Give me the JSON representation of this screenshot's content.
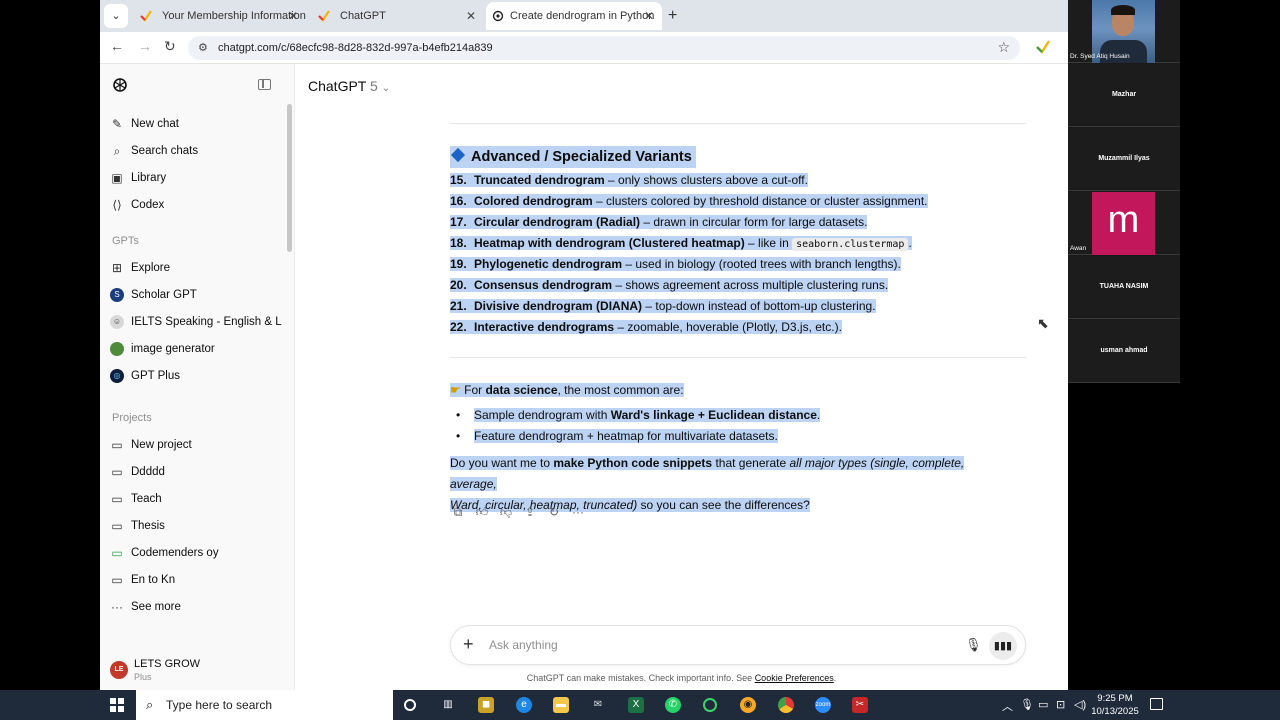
{
  "browser": {
    "tabs": [
      {
        "title": "Your Membership Information",
        "active": false
      },
      {
        "title": "ChatGPT",
        "active": false
      },
      {
        "title": "Create dendrogram in Python",
        "active": true
      }
    ],
    "url": "chatgpt.com/c/68ecfc98-8d28-832d-997a-b4efb214a839"
  },
  "sidebar": {
    "top_items": [
      {
        "label": "New chat",
        "icon": "edit-icon"
      },
      {
        "label": "Search chats",
        "icon": "search-icon"
      },
      {
        "label": "Library",
        "icon": "library-icon"
      },
      {
        "label": "Codex",
        "icon": "codex-icon"
      }
    ],
    "gpts_heading": "GPTs",
    "gpts": [
      {
        "label": "Explore",
        "icon": "grid-icon"
      },
      {
        "label": "Scholar GPT",
        "icon": "scholar-icon"
      },
      {
        "label": "IELTS Speaking - English & L...",
        "icon": "ielts-icon"
      },
      {
        "label": "image generator",
        "icon": "image-generator-icon"
      },
      {
        "label": "GPT Plus",
        "icon": "gpt-plus-icon"
      }
    ],
    "projects_heading": "Projects",
    "projects": [
      {
        "label": "New project",
        "icon": "new-folder-icon"
      },
      {
        "label": "Ddddd",
        "icon": "folder-icon"
      },
      {
        "label": "Teach",
        "icon": "folder-icon"
      },
      {
        "label": "Thesis",
        "icon": "folder-icon"
      },
      {
        "label": "Codemenders oy",
        "icon": "folder-green-icon"
      },
      {
        "label": "En to Kn",
        "icon": "folder-icon"
      },
      {
        "label": "See more",
        "icon": "more-icon"
      }
    ],
    "user": {
      "initials": "LE",
      "name": "LETS GROW",
      "plan": "Plus"
    }
  },
  "header": {
    "model": "ChatGPT",
    "version": "5"
  },
  "message": {
    "heading": "Advanced / Specialized Variants",
    "items": [
      {
        "num": "15.",
        "bold": "Truncated dendrogram",
        "rest": " – only shows clusters above a cut-off."
      },
      {
        "num": "16.",
        "bold": "Colored dendrogram",
        "rest": " – clusters colored by threshold distance or cluster assignment."
      },
      {
        "num": "17.",
        "bold": "Circular dendrogram (Radial)",
        "rest": " – drawn in circular form for large datasets."
      },
      {
        "num": "18.",
        "bold": "Heatmap with dendrogram (Clustered heatmap)",
        "rest": " – like in ",
        "code": "seaborn.clustermap",
        "after": "."
      },
      {
        "num": "19.",
        "bold": "Phylogenetic dendrogram",
        "rest": " – used in biology (rooted trees with branch lengths)."
      },
      {
        "num": "20.",
        "bold": "Consensus dendrogram",
        "rest": " – shows agreement across multiple clustering runs."
      },
      {
        "num": "21.",
        "bold": "Divisive dendrogram (DIANA)",
        "rest": " – top-down instead of bottom-up clustering."
      },
      {
        "num": "22.",
        "bold": "Interactive dendrograms",
        "rest": " – zoomable, hoverable (Plotly, D3.js, etc.)."
      }
    ],
    "ds_intro_pre": "For ",
    "ds_intro_bold": "data science",
    "ds_intro_post": ", the most common are:",
    "bullets": [
      {
        "pre": "Sample dendrogram with ",
        "bold": "Ward's linkage + Euclidean distance",
        "post": "."
      },
      {
        "pre": "Feature dendrogram + heatmap for multivariate datasets.",
        "bold": "",
        "post": ""
      }
    ],
    "question_pre": "Do you want me to ",
    "question_bold": "make Python code snippets",
    "question_mid": " that generate ",
    "question_italic_1": "all major types (single, complete, average,",
    "question_italic_2": "Ward, circular, heatmap, truncated)",
    "question_post": " so you can see the differences?"
  },
  "composer": {
    "placeholder": "Ask anything"
  },
  "footer": {
    "text": "ChatGPT can make mistakes. Check important info. See ",
    "link": "Cookie Preferences",
    "end": "."
  },
  "zoom": {
    "participants": [
      "Dr. Syed Atiq Husain",
      "Mazhar",
      "Muzammil Ilyas",
      "Awan",
      "TUAHA NASIM",
      "usman ahmad"
    ],
    "avatar_letter": "m"
  },
  "taskbar": {
    "search_placeholder": "Type here to search",
    "time": "9:25 PM",
    "date": "10/13/2025"
  },
  "colors": {
    "selection": "#bcd3f3",
    "accent_diamond": "#1b63c6",
    "avatar_tile": "#c2185b",
    "taskbar": "#1f2a3b"
  }
}
